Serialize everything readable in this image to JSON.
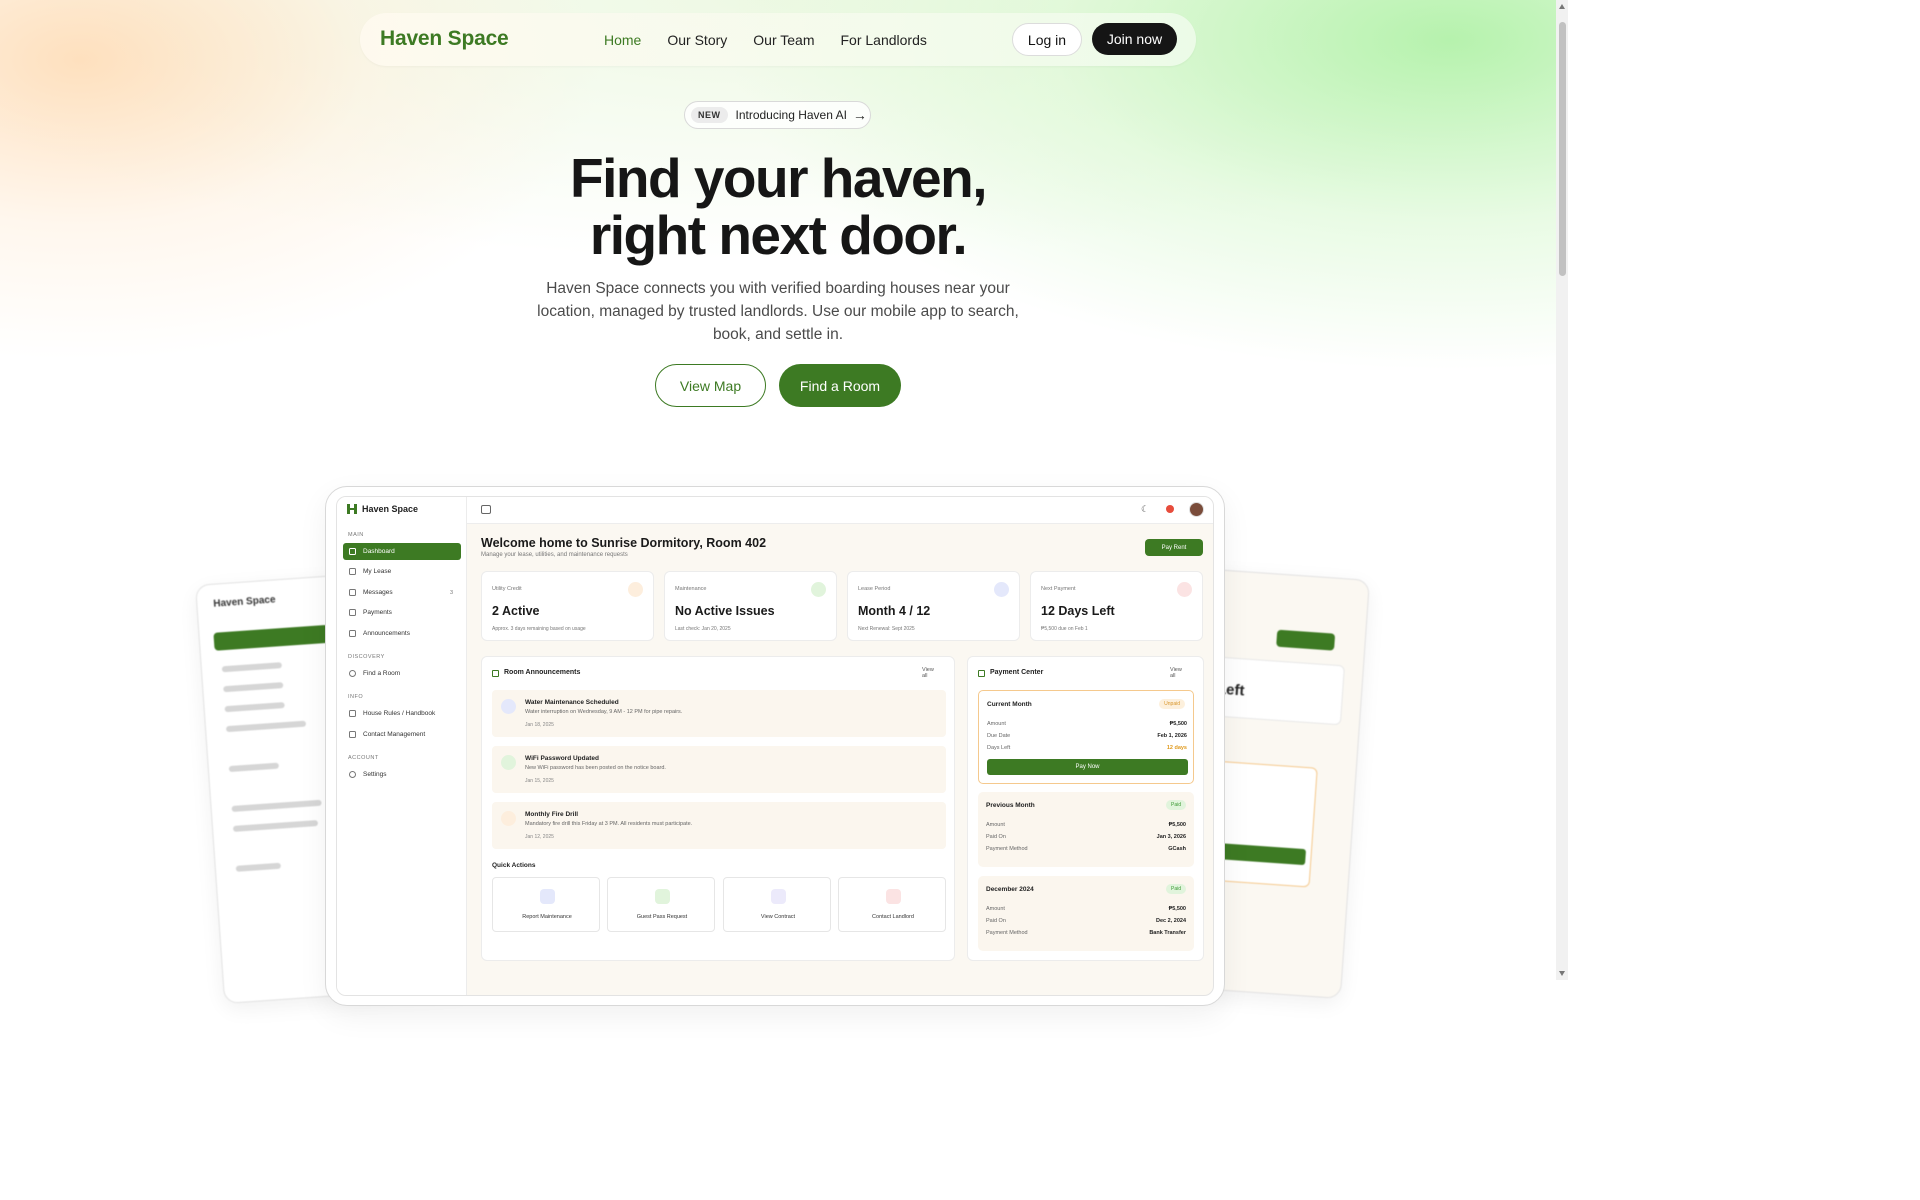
{
  "nav": {
    "brand": "Haven Space",
    "links": [
      "Home",
      "Our Story",
      "Our Team",
      "For Landlords"
    ],
    "login": "Log in",
    "join": "Join now"
  },
  "hero": {
    "badge": "NEW",
    "announcement": "Introducing Haven AI",
    "title_line1": "Find your haven,",
    "title_line2": "right next door.",
    "subtitle": "Haven Space connects you with verified boarding houses near your location, managed by trusted landlords. Use our mobile app to search, book, and settle in.",
    "btn_map": "View Map",
    "btn_find": "Find a Room"
  },
  "colors": {
    "brand": "#3d7a23",
    "dark_button": "#151515",
    "warning": "#e09a1d",
    "paid": "#3d9a35"
  },
  "app": {
    "brand": "Haven Space",
    "sections": {
      "main": "MAIN",
      "discovery": "DISCOVERY",
      "info": "INFO",
      "account": "ACCOUNT"
    },
    "sidebar": {
      "dashboard": "Dashboard",
      "lease": "My Lease",
      "messages": "Messages",
      "messages_count": "3",
      "payments": "Payments",
      "announcements": "Announcements",
      "find_room": "Find a Room",
      "house_rules": "House Rules / Handbook",
      "contact": "Contact Management",
      "settings": "Settings"
    },
    "welcome": "Welcome home to Sunrise Dormitory, Room 402",
    "welcome_sub": "Manage your lease, utilities, and maintenance requests",
    "pay_rent": "Pay Rent",
    "stats": [
      {
        "label": "Utility Credit",
        "value": "2 Active",
        "note": "Approx. 3 days remaining based on usage"
      },
      {
        "label": "Maintenance",
        "value": "No Active Issues",
        "note": "Last check: Jan 20, 2025"
      },
      {
        "label": "Lease Period",
        "value": "Month 4 / 12",
        "note": "Next Renewal: Sept 2025"
      },
      {
        "label": "Next Payment",
        "value": "12 Days Left",
        "note": "₱5,500 due on Feb 1"
      }
    ],
    "announcements": {
      "title": "Room Announcements",
      "view_all_1": "View",
      "view_all_2": "all",
      "items": [
        {
          "title": "Water Maintenance Scheduled",
          "desc": "Water interruption on Wednesday, 9 AM - 12 PM for pipe repairs.",
          "date": "Jan 18, 2025"
        },
        {
          "title": "WiFi Password Updated",
          "desc": "New WiFi password has been posted on the notice board.",
          "date": "Jan 15, 2025"
        },
        {
          "title": "Monthly Fire Drill",
          "desc": "Mandatory fire drill this Friday at 3 PM. All residents must participate.",
          "date": "Jan 12, 2025"
        }
      ]
    },
    "quick_actions": {
      "title": "Quick Actions",
      "items": [
        "Report Maintenance",
        "Guest Pass Request",
        "View Contract",
        "Contact Landlord"
      ]
    },
    "payment_center": {
      "title": "Payment Center",
      "view_all_1": "View",
      "view_all_2": "all",
      "current": {
        "title": "Current Month",
        "badge": "Unpaid",
        "amount_label": "Amount",
        "amount": "₱5,500",
        "due_label": "Due Date",
        "due": "Feb 1, 2026",
        "days_label": "Days Left",
        "days": "12 days",
        "pay_now": "Pay Now"
      },
      "previous": {
        "title": "Previous Month",
        "badge": "Paid",
        "amount_label": "Amount",
        "amount": "₱5,500",
        "paid_label": "Paid On",
        "paid": "Jan 3, 2026",
        "method_label": "Payment Method",
        "method": "GCash"
      },
      "december": {
        "title": "December 2024",
        "badge": "Paid",
        "amount_label": "Amount",
        "amount": "₱5,500",
        "paid_label": "Paid On",
        "paid": "Dec 2, 2024",
        "method_label": "Payment Method",
        "method": "Bank Transfer"
      }
    }
  },
  "side_mockups": {
    "left_brand": "Haven Space",
    "right_value": "Left"
  }
}
